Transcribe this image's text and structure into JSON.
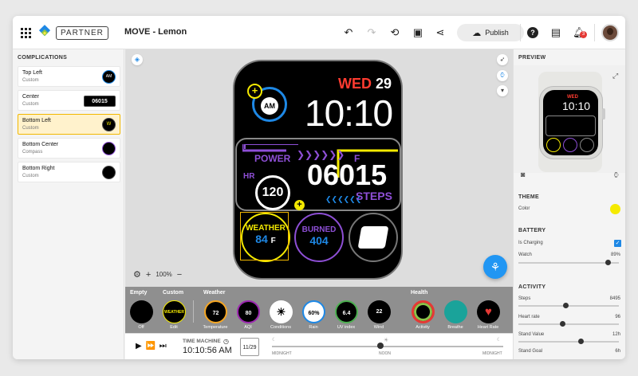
{
  "topbar": {
    "partner": "PARTNER",
    "title": "MOVE - Lemon",
    "publish": "Publish",
    "notif_count": "3"
  },
  "left": {
    "header": "COMPLICATIONS",
    "items": [
      {
        "name": "Top Left",
        "sub": "Custom",
        "thumb": "AM"
      },
      {
        "name": "Center",
        "sub": "Custom",
        "thumb": "06015"
      },
      {
        "name": "Bottom Left",
        "sub": "Custom",
        "thumb": "W"
      },
      {
        "name": "Bottom Center",
        "sub": "Compass",
        "thumb": ""
      },
      {
        "name": "Bottom Right",
        "sub": "Custom",
        "thumb": ""
      }
    ],
    "selected_index": 2
  },
  "watch": {
    "day": "WED",
    "date": "29",
    "time": "10:10",
    "am": "AM",
    "power": "POWER",
    "f": "F",
    "hr": "HR",
    "hr_value": "120",
    "steps_value": "06015",
    "steps": "STEPS",
    "weather": "WEATHER",
    "temp": "84",
    "temp_unit": "F",
    "burned": "BURNED",
    "burned_value": "404"
  },
  "canvas": {
    "zoom": "100%"
  },
  "tray": {
    "groups": [
      "Empty",
      "Custom",
      "Weather",
      "Health"
    ],
    "items": [
      {
        "label": "Off",
        "value": ""
      },
      {
        "label": "Edit",
        "value": "WEATHER"
      },
      {
        "label": "Temperature",
        "value": "72"
      },
      {
        "label": "AQI",
        "value": "80"
      },
      {
        "label": "Conditions",
        "value": "☀"
      },
      {
        "label": "Rain",
        "value": "60%"
      },
      {
        "label": "UV index",
        "value": "6.4"
      },
      {
        "label": "Wind",
        "value": "22"
      },
      {
        "label": "Activity",
        "value": ""
      },
      {
        "label": "Breathe",
        "value": ""
      },
      {
        "label": "Heart Rate",
        "value": "♥"
      }
    ]
  },
  "timemachine": {
    "label": "TIME MACHINE",
    "time": "10:10:56 AM",
    "date": "11/29",
    "midnight": "MIDNIGHT",
    "noon": "NOON",
    "midnight2": "MIDNIGHT",
    "position": 0.47
  },
  "right": {
    "preview": "PREVIEW",
    "theme": "THEME",
    "color_label": "Color",
    "theme_color": "#f5ea00",
    "battery": "BATTERY",
    "charging": "Is Charging",
    "watch_label": "Watch",
    "watch_value": "89%",
    "watch_level": 0.89,
    "activity": "ACTIVITY",
    "stats": [
      {
        "label": "Steps",
        "value": "8495",
        "level": 0.47
      },
      {
        "label": "Heart rate",
        "value": "96",
        "level": 0.44
      },
      {
        "label": "Stand Value",
        "value": "12h",
        "level": 0.62
      },
      {
        "label": "Stand Goal",
        "value": "6h",
        "level": 0.5
      }
    ]
  }
}
